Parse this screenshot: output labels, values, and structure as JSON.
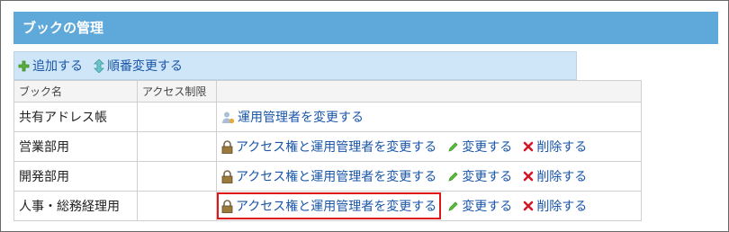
{
  "page": {
    "title": "ブックの管理"
  },
  "toolbar": {
    "add_label": "追加する",
    "reorder_label": "順番変更する"
  },
  "table": {
    "headers": [
      "ブック名",
      "アクセス制限",
      ""
    ],
    "rows": [
      {
        "name": "共有アドレス帳",
        "access": "",
        "change_admin_label": "運用管理者を変更する"
      },
      {
        "name": "営業部用",
        "access": "",
        "change_access_label": "アクセス権と運用管理者を変更する",
        "edit_label": "変更する",
        "delete_label": "削除する"
      },
      {
        "name": "開発部用",
        "access": "",
        "change_access_label": "アクセス権と運用管理者を変更する",
        "edit_label": "変更する",
        "delete_label": "削除する"
      },
      {
        "name": "人事・総務経理用",
        "access": "",
        "change_access_label": "アクセス権と運用管理者を変更する",
        "edit_label": "変更する",
        "delete_label": "削除する"
      }
    ]
  },
  "colors": {
    "title_bg": "#5ea8da",
    "toolbar_bg": "#cfe6f8",
    "link": "#1a56a8",
    "highlight": "#e01515",
    "delete_icon": "#d0182a",
    "edit_icon": "#3e9a28"
  },
  "icons": {
    "add": "plus-icon",
    "reorder": "up-down-arrow-icon",
    "admin": "user-icon",
    "access": "lock-icon",
    "edit": "pencil-icon",
    "delete": "x-icon"
  }
}
